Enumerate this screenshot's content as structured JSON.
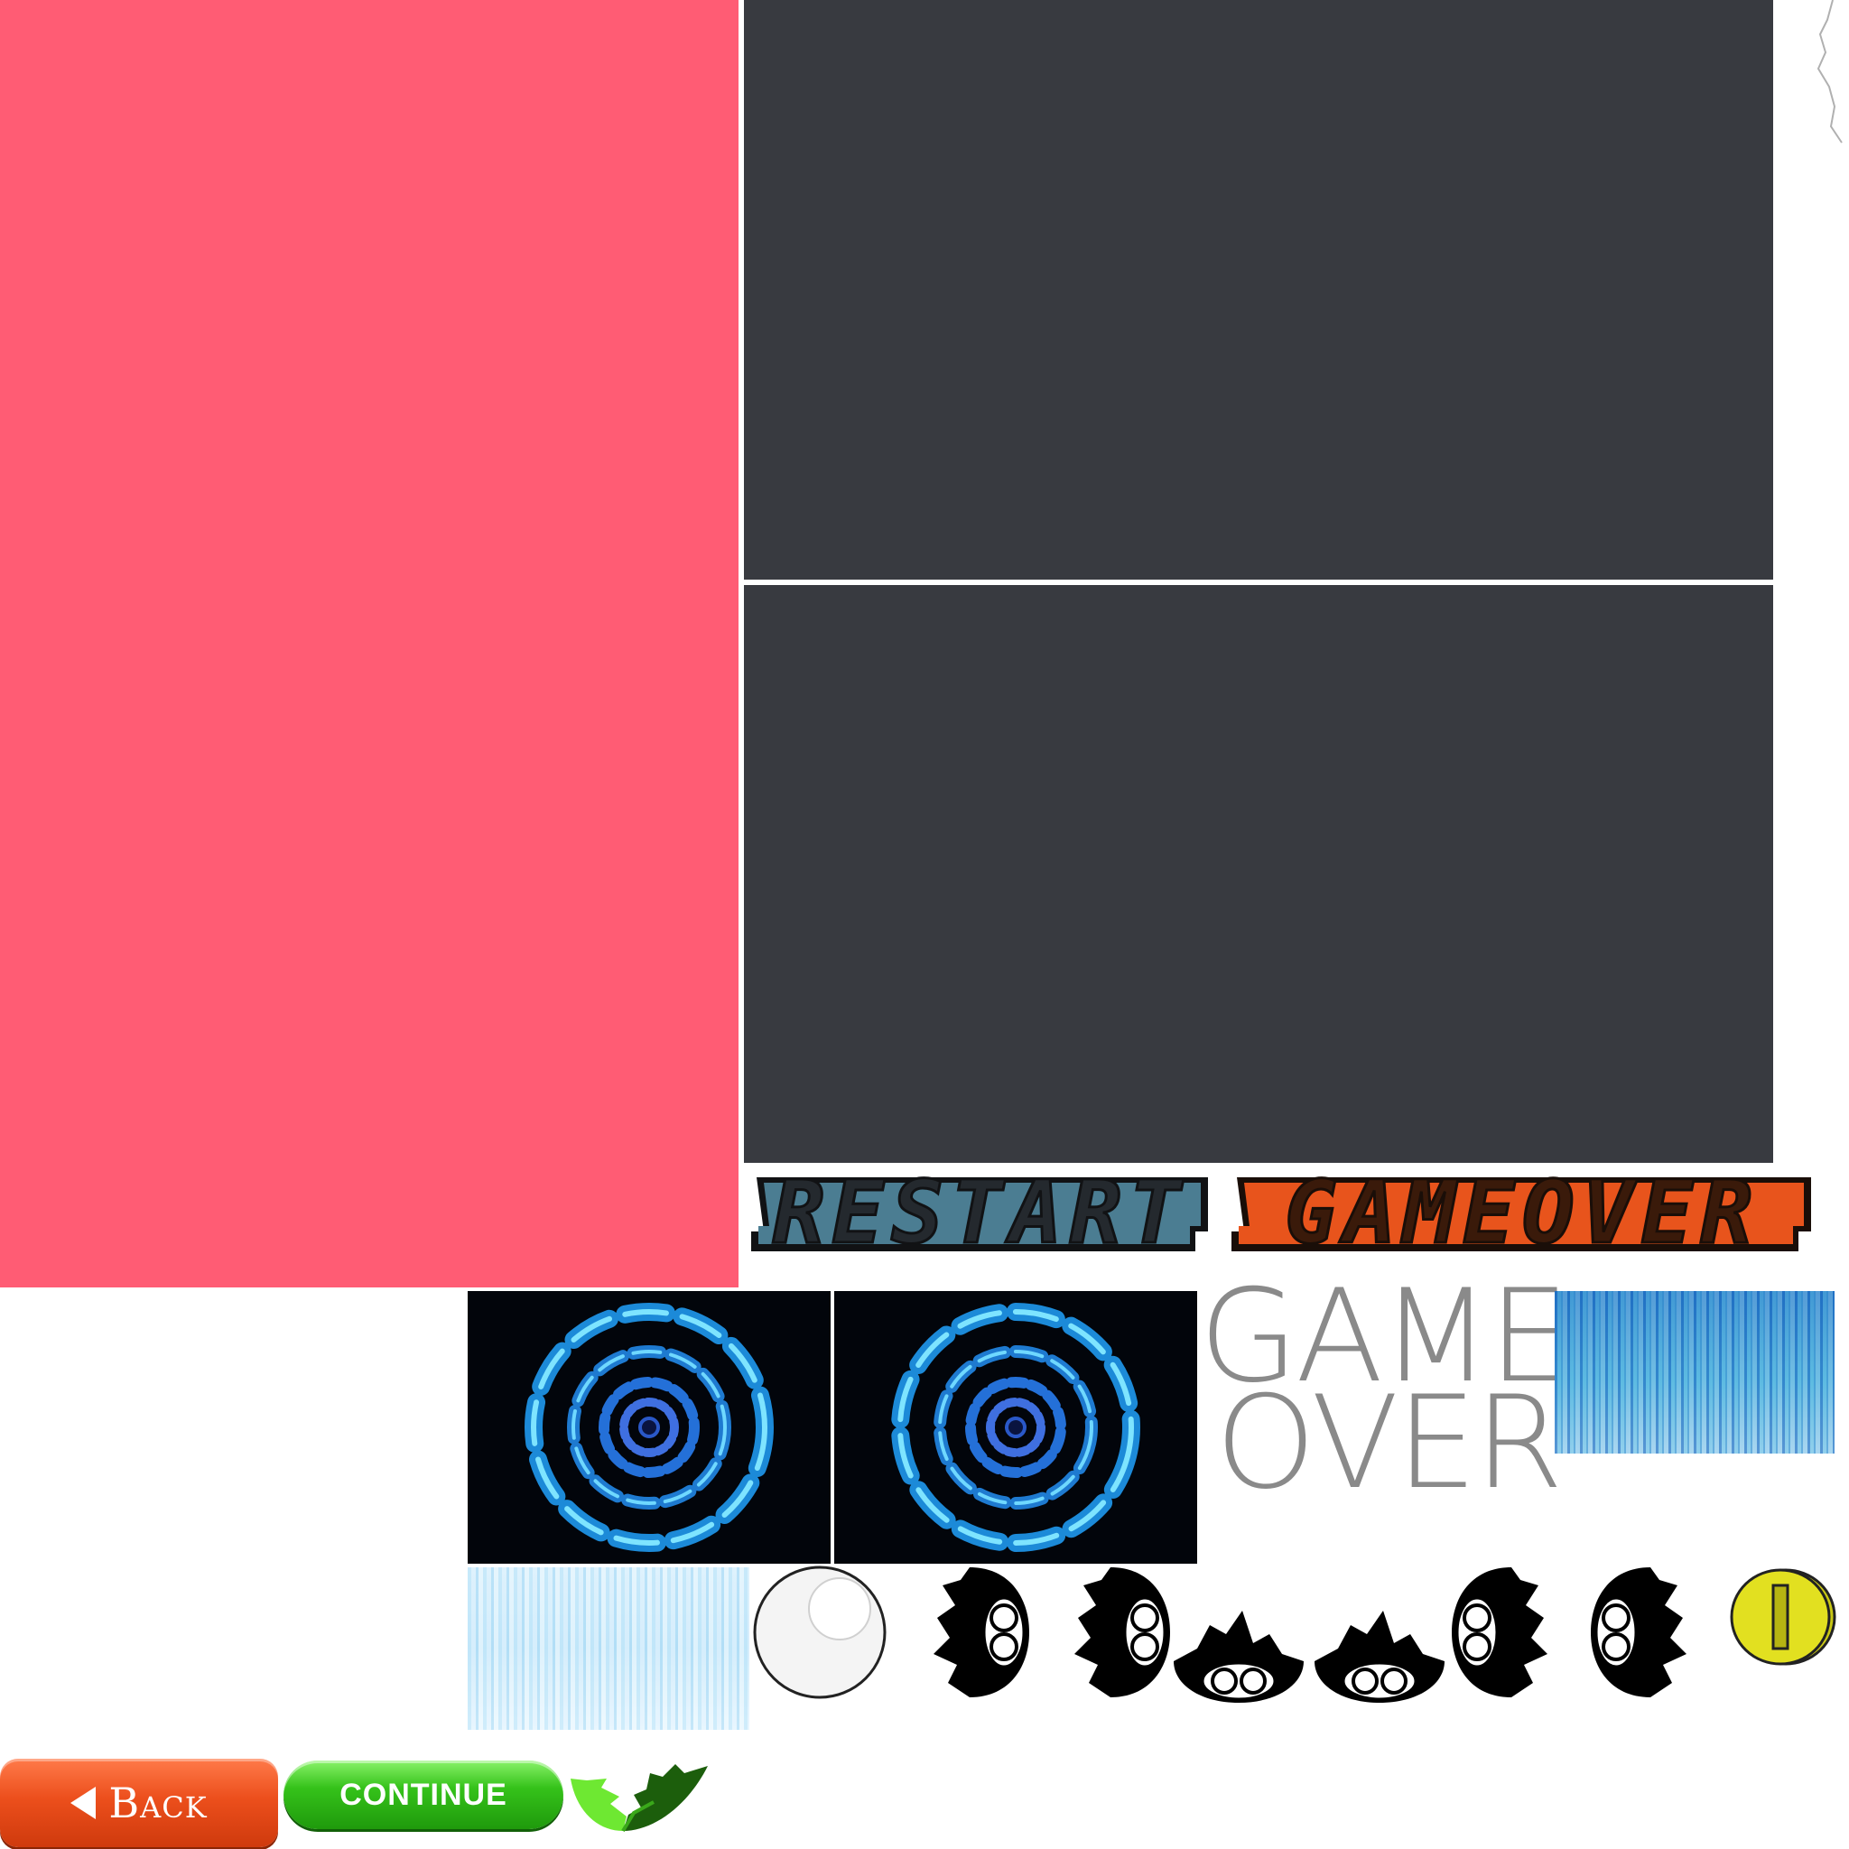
{
  "colors": {
    "pink": "#ff5c74",
    "panel": "#383a40",
    "restart_fill": "#4b7d92",
    "gameover_fill": "#e8541c",
    "coin": "#e2e020"
  },
  "titles": {
    "restart": "RESTART",
    "game_over_pixel": "GAMEOVER",
    "game_over_line1": "GAME",
    "game_over_line2": "OVER"
  },
  "buttons": {
    "back": "Back",
    "continue": "CONTINUE"
  },
  "icons": {
    "back_arrow": "left-triangle-icon",
    "coin": "gold-coin-icon",
    "orb": "white-orb-icon",
    "creature": "black-chomper-icon",
    "leaf": "green-leaf-icon",
    "portal": "blue-portal-icon"
  }
}
